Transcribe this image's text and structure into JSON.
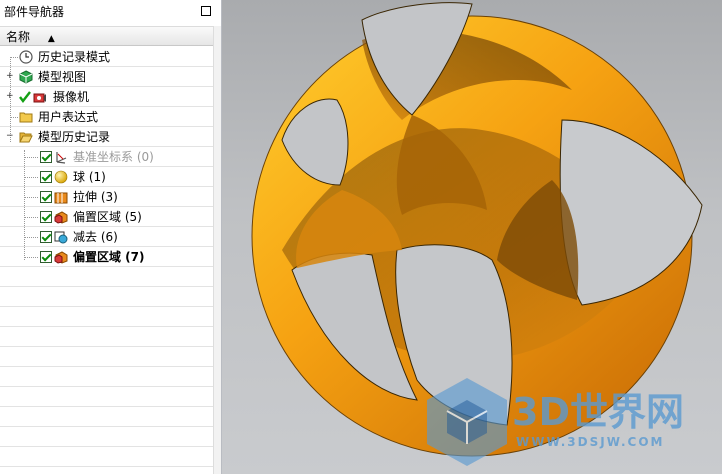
{
  "navigator": {
    "title": "部件导航器",
    "column_header": "名称",
    "items": [
      {
        "label": "历史记录模式",
        "icon": "clock-icon"
      },
      {
        "label": "模型视图",
        "icon": "model-view-icon"
      },
      {
        "label": "摄像机",
        "icon": "camera-icon"
      },
      {
        "label": "用户表达式",
        "icon": "folder-icon"
      },
      {
        "label": "模型历史记录",
        "icon": "folder-open-icon"
      },
      {
        "label": "基准坐标系 (0)",
        "icon": "datum-csys-icon"
      },
      {
        "label": "球 (1)",
        "icon": "sphere-icon"
      },
      {
        "label": "拉伸 (3)",
        "icon": "extrude-icon"
      },
      {
        "label": "偏置区域 (5)",
        "icon": "offset-region-icon"
      },
      {
        "label": "减去 (6)",
        "icon": "subtract-icon"
      },
      {
        "label": "偏置区域 (7)",
        "icon": "offset-region-icon"
      }
    ]
  },
  "watermark": {
    "brand": "3D世界网",
    "url": "WWW.3DSJW.COM"
  },
  "colors": {
    "model_orange": "#f39c0d",
    "model_dark": "#7a4a08",
    "viewport_bg": "#bfc1c4"
  }
}
